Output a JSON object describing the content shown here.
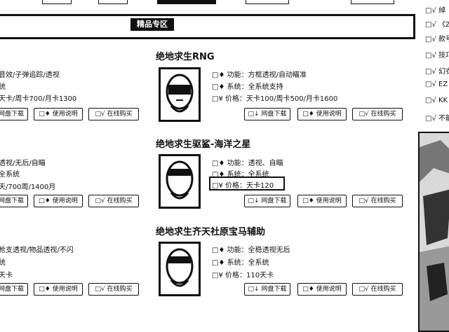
{
  "banner": {
    "title": "精品专区"
  },
  "buttons": {
    "download": "网盘下载",
    "guide": "使用说明",
    "buy": "在线购买"
  },
  "products": [
    {
      "title": "绝地求生RNG",
      "func_label": "功能：",
      "func_value": "方框透视/自动瞄准",
      "sys_label": "系统：",
      "sys_value": "全系统支持",
      "price_label": "价格：",
      "price_value": "天卡100/周卡500/月卡1600"
    },
    {
      "title": "绝地求生驱鲨-海洋之星",
      "func_label": "功能：",
      "func_value": "透视、自瞄",
      "sys_label": "系统：",
      "sys_value": "全系统",
      "price_label": "价格：",
      "price_value": "天卡120"
    },
    {
      "title": "绝地求生齐天社原宝马辅助",
      "func_label": "功能：",
      "func_value": "全稳透视无后",
      "sys_label": "系统：",
      "sys_value": "全系统",
      "price_label": "价格：",
      "price_value": "110天卡"
    }
  ],
  "left_partial": [
    {
      "line1": "音效/子弹追踪/透视",
      "line2": "统",
      "line3": "天卡/周卡700/月卡1300"
    },
    {
      "line1": "透视/无后/自瞄",
      "line2": "全系统",
      "line3": "天/700周/1400月"
    },
    {
      "line1": "枪支透视/物品透视/不闪",
      "line2": "统",
      "line3": "天卡"
    }
  ],
  "right_sidebar": {
    "items": [
      "绰",
      "《Z",
      "款号",
      "技巧",
      "幻衣",
      "EZ",
      "KK",
      "不能"
    ]
  }
}
